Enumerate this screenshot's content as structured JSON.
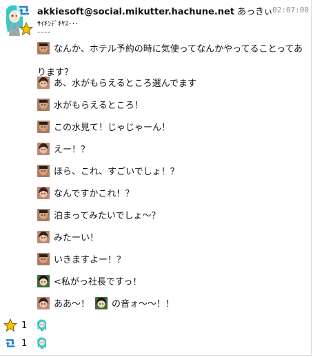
{
  "post": {
    "screen_name": "akkiesoft@social.mikutter.hachune.net",
    "display_name": "あっきぃ",
    "timestamp": "02:07:00",
    "subtitle": "ｻｲｷﾝﾃﾞｷﾔｽ･･･",
    "separator": "----",
    "line1_a": "なんか、ホテル予約の時に気使ってなんかやってることってあ",
    "line1_b": "ります？",
    "lines": [
      "あ、水がもらえるところ選んでます",
      "水がもらえるところ！",
      "この水見て！じゃじゃーん！",
      "えー！？",
      "ほら、これ、すごいでしょ！？",
      "なんですかこれ！？",
      "泊まってみたいでしょ〜？",
      "みたーい！",
      "いきますよー！？",
      "<私がっ社長ですっ！"
    ],
    "last_line_a": "ああ〜！",
    "last_line_b": "の音ォ〜〜！！"
  },
  "reactions": {
    "favorite_count": "1",
    "retweet_count": "1"
  },
  "colors": {
    "accent": "#1e7fd4",
    "star": "#f5c400",
    "timestamp": "#8a8a8a"
  },
  "icons": {
    "retweet": "retweet-icon",
    "favorite": "star-icon"
  }
}
